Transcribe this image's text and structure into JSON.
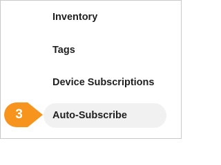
{
  "nav": {
    "items": [
      {
        "label": "Inventory",
        "active": false
      },
      {
        "label": "Tags",
        "active": false
      },
      {
        "label": "Device Subscriptions",
        "active": false
      },
      {
        "label": "Auto-Subscribe",
        "active": true
      }
    ]
  },
  "callout": {
    "step_number": "3",
    "color": "#f7941d"
  }
}
